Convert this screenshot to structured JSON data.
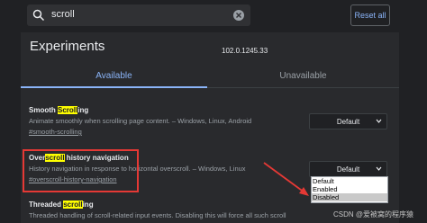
{
  "search": {
    "query": "scroll",
    "reset_label": "Reset all"
  },
  "header": {
    "title": "Experiments",
    "version": "102.0.1245.33"
  },
  "tabs": [
    {
      "label": "Available"
    },
    {
      "label": "Unavailable"
    }
  ],
  "experiments": [
    {
      "name_pre": "Smooth ",
      "name_hl": "Scroll",
      "name_post": "ing",
      "description": "Animate smoothly when scrolling page content. – Windows, Linux, Android",
      "link": "#smooth-scrolling",
      "value": "Default"
    },
    {
      "name_pre": "Over",
      "name_hl": "scroll",
      "name_post": " history navigation",
      "description": "History navigation in response to horizontal overscroll. – Windows, Linux",
      "link": "#overscroll-history-navigation",
      "value": "Default"
    },
    {
      "name_pre": "Threaded ",
      "name_hl": "scroll",
      "name_post": "ing",
      "description": "Threaded handling of scroll-related input events. Disabling this will force all such scroll"
    }
  ],
  "dropdown_options": [
    "Default",
    "Enabled",
    "Disabled"
  ],
  "dropdown_selected": "Disabled",
  "watermark": "CSDN @爱被窝的程序猿",
  "colors": {
    "accent": "#8ab4f8",
    "highlight": "#ffff00",
    "annotation": "#e53935"
  }
}
